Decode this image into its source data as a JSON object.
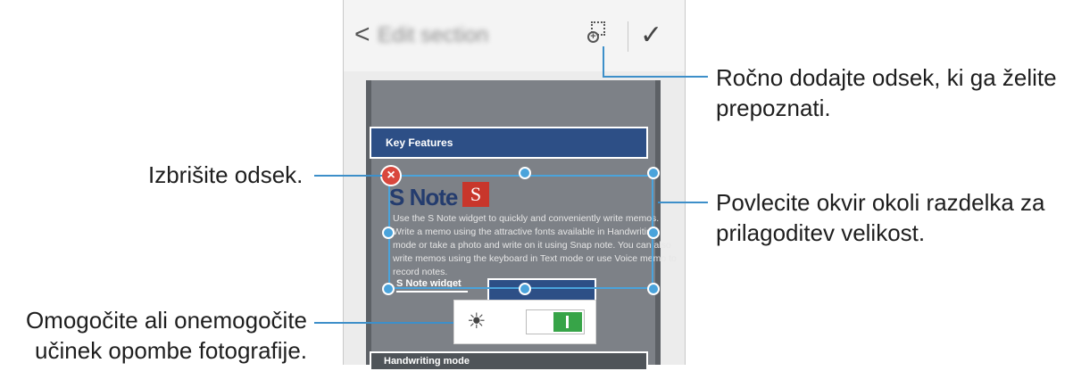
{
  "app_bar": {
    "back_glyph": "<",
    "title": "Edit section",
    "confirm_glyph": "✓",
    "add_section_icon": "add-section-icon"
  },
  "document": {
    "key_features": "Key Features",
    "s_note_title": "S Note",
    "logo_letter": "S",
    "body_lines": [
      "Use the S Note widget to quickly and conveniently write memos.",
      "Write a memo using the attractive fonts available in Handwriting",
      "mode or take a photo and write on it using Snap note. You can also",
      "write memos using the keyboard in Text mode or use Voice memo to",
      "record notes."
    ],
    "widget_heading": "S Note widget",
    "handwriting_heading": "Handwriting mode"
  },
  "photo_effect": {
    "icon": "magic-wand-icon",
    "toggle_state": "on"
  },
  "callouts": {
    "add_section": "Ročno dodajte odsek, ki ga želite\nprepoznati.",
    "delete_section": "Izbrišite odsek.",
    "resize": "Povlecite okvir okoli razdelka za\nprilagoditev velikost.",
    "photo_note": "Omogočite ali onemogočite\nučinek opombe fotografije."
  },
  "colors": {
    "accent_line": "#3d8fc9",
    "handle": "#4aa3db",
    "delete": "#d9473d",
    "toggle_on": "#37a448"
  }
}
